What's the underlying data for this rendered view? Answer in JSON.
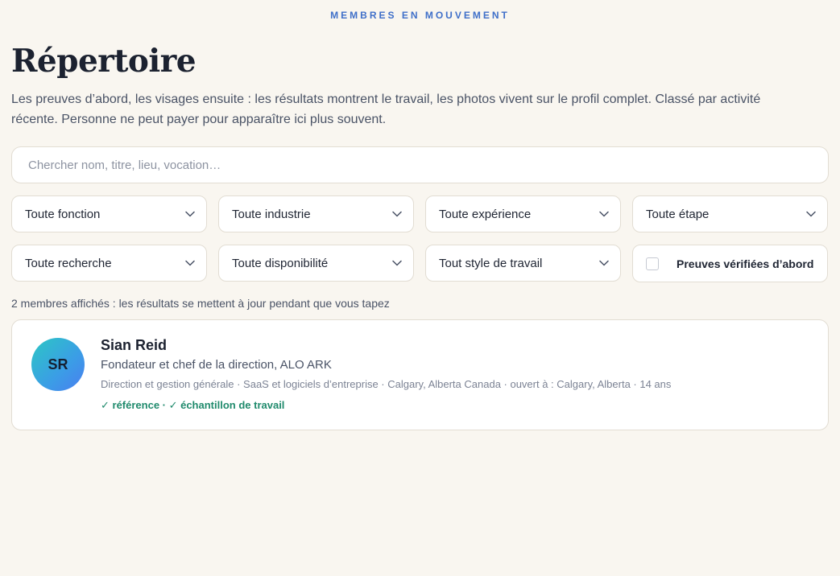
{
  "header": {
    "eyebrow": "MEMBRES EN MOUVEMENT",
    "title": "Répertoire",
    "intro": "Les preuves d’abord, les visages ensuite : les résultats montrent le travail, les photos vivent sur le profil complet. Classé par activité récente. Personne ne peut payer pour apparaître ici plus souvent."
  },
  "search": {
    "placeholder": "Chercher nom, titre, lieu, vocation…",
    "value": ""
  },
  "filters": {
    "function": "Toute fonction",
    "industry": "Toute industrie",
    "experience": "Toute expérience",
    "stage": "Toute étape",
    "research": "Toute recherche",
    "availability": "Toute disponibilité",
    "work_style": "Tout style de travail",
    "verified_proofs_label": "Preuves vérifiées d’abord",
    "verified_proofs_checked": false
  },
  "results": {
    "count_text": "2 membres affichés : les résultats se mettent à jour pendant que vous tapez",
    "members": [
      {
        "initials": "SR",
        "name": "Sian Reid",
        "role": "Fondateur et chef de la direction, ALO ARK",
        "meta": "Direction et gestion générale · SaaS et logiciels d’entreprise · Calgary, Alberta Canada · ouvert à : Calgary, Alberta · 14 ans",
        "proofs": "✓ référence · ✓ échantillon de travail"
      }
    ]
  },
  "colors": {
    "background": "#f9f6f0",
    "accent": "#3f6fc9",
    "proof_green": "#1f8a6c",
    "avatar_gradient_start": "#2cc7c4",
    "avatar_gradient_end": "#4a7ef0"
  },
  "icons": {
    "select_indicator": "chevron-down-icon",
    "checkbox": "checkbox-icon"
  }
}
